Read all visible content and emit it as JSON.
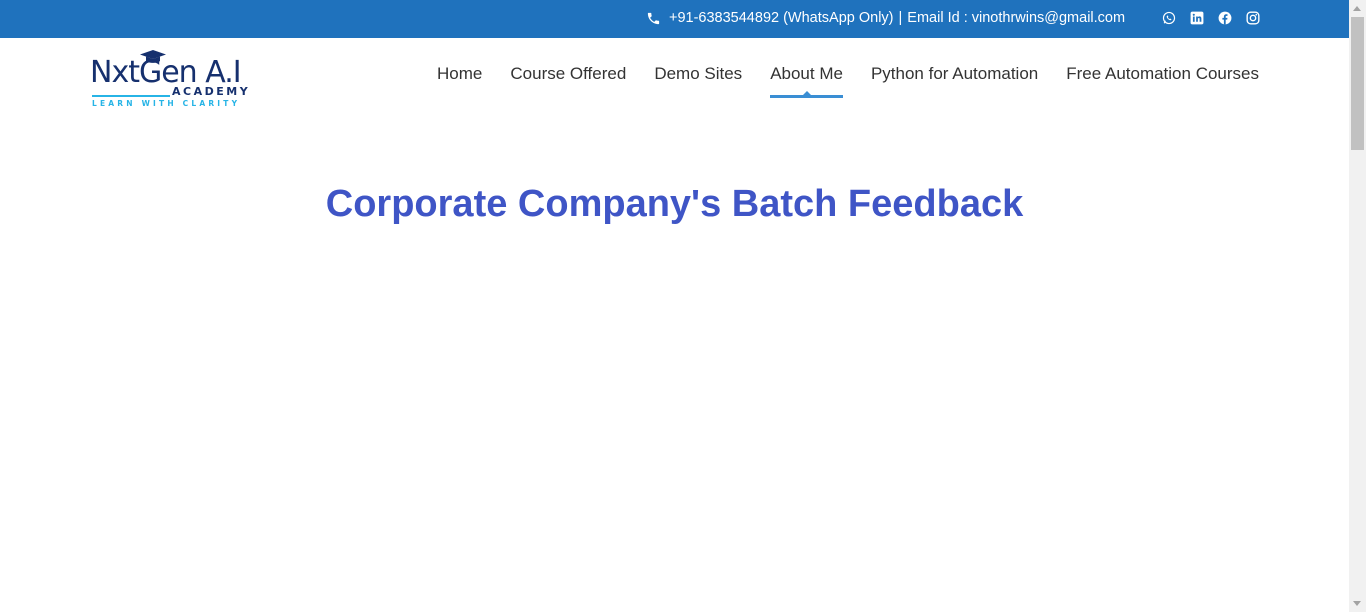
{
  "topbar": {
    "phone": "+91-6383544892 (WhatsApp Only)",
    "separator": "|",
    "email": "Email Id : vinothrwins@gmail.com",
    "icons": [
      "phone-icon",
      "whatsapp-icon",
      "linkedin-icon",
      "facebook-icon",
      "instagram-icon"
    ],
    "color": "#1f72bd"
  },
  "logo": {
    "main": "NxtGen A.I",
    "sub": "ACADEMY",
    "tagline": "LEARN WITH CLARITY"
  },
  "nav": {
    "items": [
      {
        "label": "Home"
      },
      {
        "label": "Course Offered"
      },
      {
        "label": "Demo Sites"
      },
      {
        "label": "About Me"
      },
      {
        "label": "Python for Automation"
      },
      {
        "label": "Free Automation Courses"
      }
    ],
    "active": "About Me",
    "active_color": "#3a8ed4"
  },
  "main": {
    "title": "Corporate Company's Batch Feedback",
    "title_color": "#3f55c6"
  }
}
